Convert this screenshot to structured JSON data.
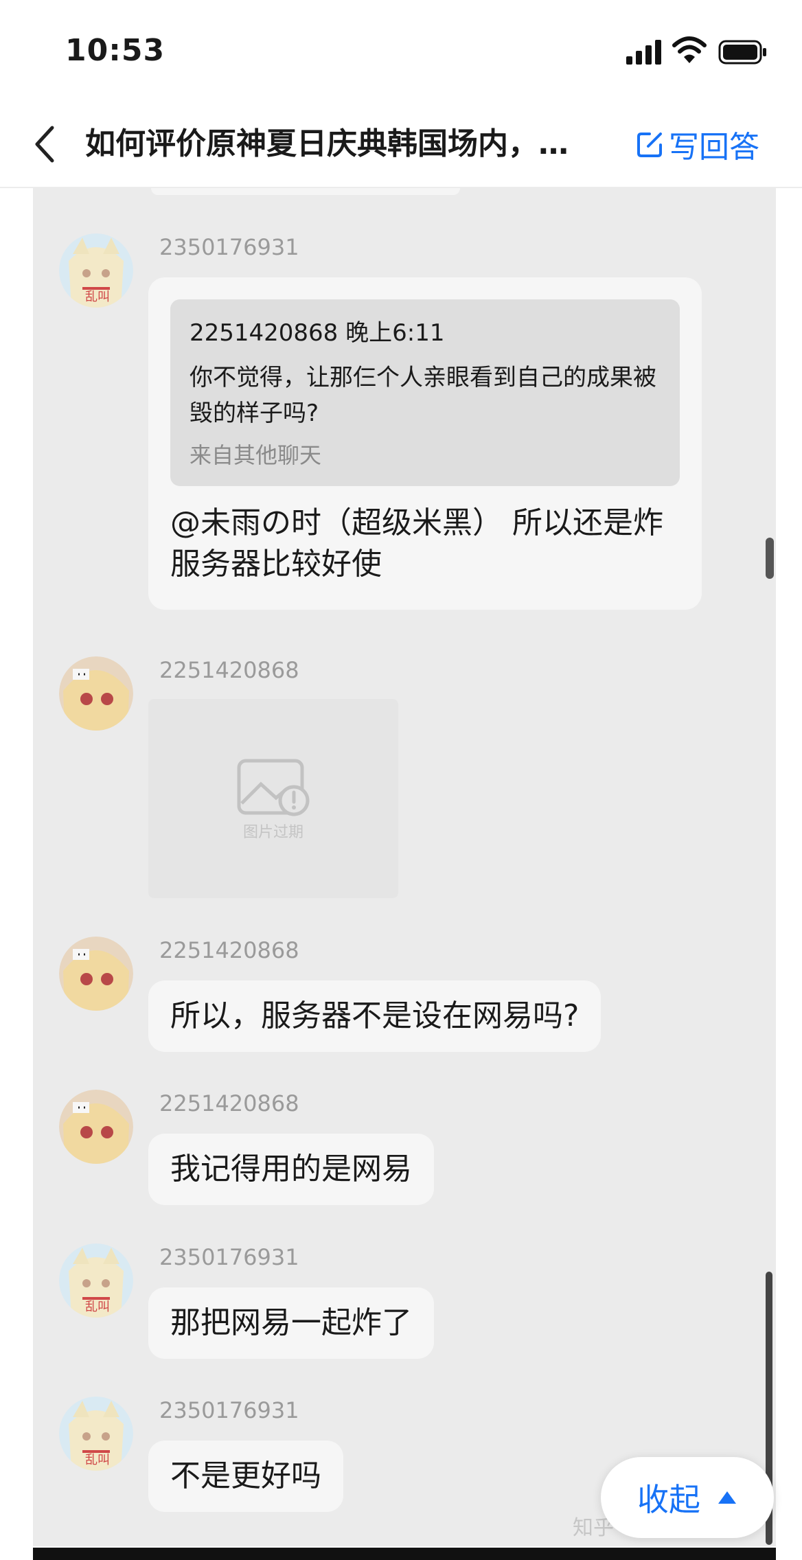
{
  "status_bar": {
    "time": "10:53"
  },
  "nav": {
    "title": "如何评价原神夏日庆典韩国场内，…",
    "write_answer": "写回答"
  },
  "messages": [
    {
      "user": "2350176931",
      "quote": {
        "header": "2251420868 晚上6:11",
        "text": "你不觉得，让那仨个人亲眼看到自己的成果被毁的样子吗?",
        "source": "来自其他聊天"
      },
      "text": "@未雨の时（超级米黑） 所以还是炸服务器比较好使"
    },
    {
      "user": "2251420868",
      "image_label": "图片过期"
    },
    {
      "user": "2251420868",
      "text": "所以，服务器不是设在网易吗?"
    },
    {
      "user": "2251420868",
      "text": "我记得用的是网易"
    },
    {
      "user": "2350176931",
      "text": "那把网易一起炸了"
    },
    {
      "user": "2350176931",
      "text": "不是更好吗"
    }
  ],
  "collapse_label": "收起",
  "watermark": "知乎",
  "colors": {
    "accent": "#1772f6",
    "chat_background": "#ebebeb",
    "bubble": "#f6f6f6"
  },
  "icons": [
    "back-icon",
    "edit-icon",
    "signal-icon",
    "wifi-icon",
    "battery-icon",
    "image-expired-icon",
    "chevron-up-icon"
  ]
}
